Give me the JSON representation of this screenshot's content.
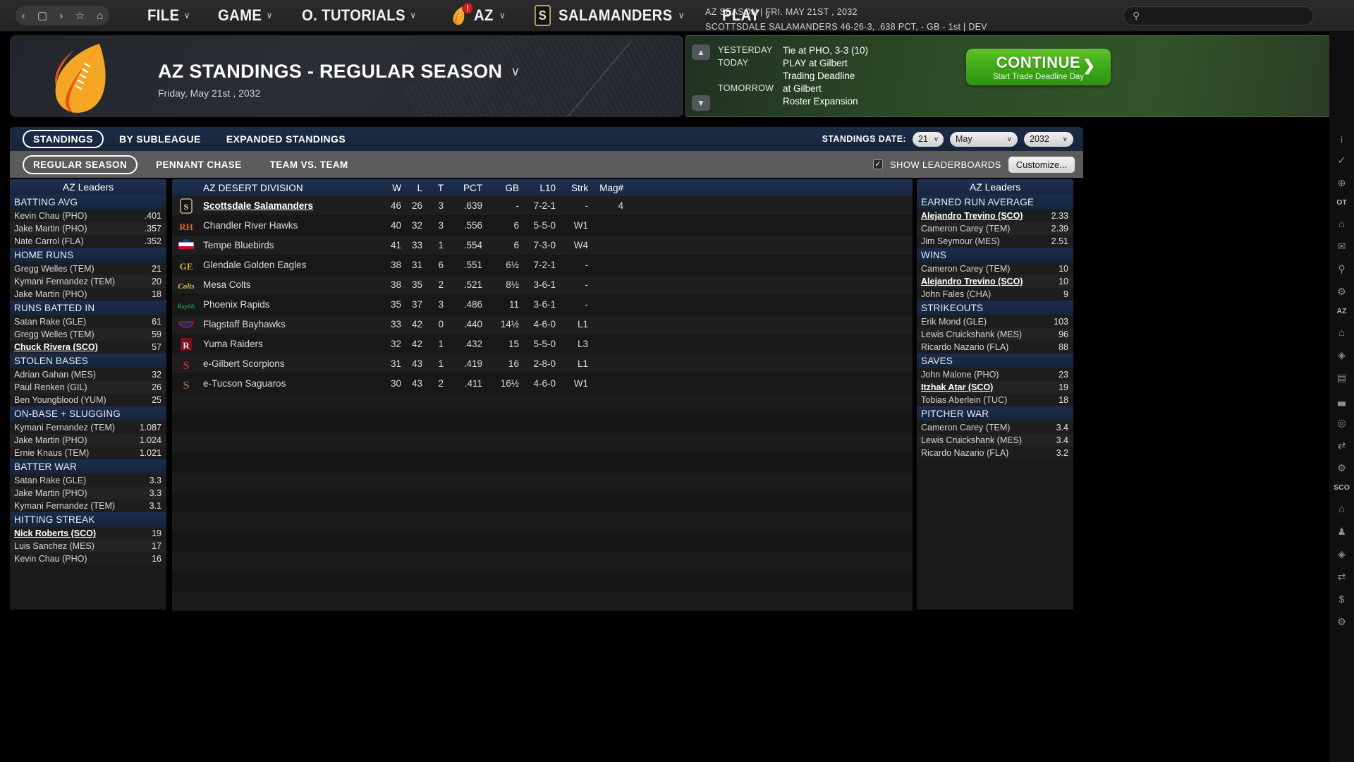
{
  "topbar": {
    "nav_icons": [
      "back-icon",
      "page-icon",
      "forward-icon",
      "star-icon",
      "home-icon"
    ],
    "menus": [
      {
        "label": "FILE",
        "caret": "∨"
      },
      {
        "label": "GAME",
        "caret": "∨"
      },
      {
        "label": "O. TUTORIALS",
        "caret": "∨"
      },
      {
        "label": "AZ",
        "caret": "∨",
        "badge": "!"
      },
      {
        "label": "SALAMANDERS",
        "caret": "∨"
      },
      {
        "label": "PLAY",
        "caret": "∨"
      }
    ],
    "season_line1": "AZ SEASON  |  FRI. MAY 21ST , 2032",
    "season_line2": "SCOTTSDALE SALAMANDERS   46-26-3, .638 PCT, - GB - 1st | DEV",
    "search_placeholder": ""
  },
  "banner": {
    "title": "AZ STANDINGS - REGULAR SEASON",
    "caret": "∨",
    "subtitle": "Friday, May 21st , 2032"
  },
  "schedule": {
    "rows": [
      {
        "when": "YESTERDAY",
        "what": "Tie at PHO, 3-3 (10)"
      },
      {
        "when": "TODAY",
        "what": "PLAY at Gilbert"
      },
      {
        "when": "",
        "what": "Trading Deadline"
      },
      {
        "when": "TOMORROW",
        "what": "at Gilbert"
      },
      {
        "when": "",
        "what": "Roster Expansion"
      }
    ],
    "continue_label": "CONTINUE",
    "continue_sub": "Start Trade Deadline Day",
    "continue_arrow": "❯",
    "expand_icon": "»",
    "accent_color": "#3faa18"
  },
  "tabs_primary": [
    {
      "label": "STANDINGS",
      "active": true
    },
    {
      "label": "BY SUBLEAGUE",
      "active": false
    },
    {
      "label": "EXPANDED STANDINGS",
      "active": false
    }
  ],
  "tabs_secondary": [
    {
      "label": "REGULAR SEASON",
      "active": true
    },
    {
      "label": "PENNANT CHASE",
      "active": false
    },
    {
      "label": "TEAM VS. TEAM",
      "active": false
    }
  ],
  "standings_date": {
    "label": "STANDINGS DATE:",
    "day": "21",
    "month": "May",
    "year": "2032",
    "caret": "∨"
  },
  "leaderboard_controls": {
    "checkbox_checked": "✓",
    "show_leaderboards_label": "SHOW LEADERBOARDS",
    "customize_label": "Customize..."
  },
  "leaders_left": {
    "title": "AZ Leaders",
    "categories": [
      {
        "name": "BATTING AVG",
        "rows": [
          {
            "player": "Kevin Chau (PHO)",
            "value": ".401",
            "highlight": false
          },
          {
            "player": "Jake Martin (PHO)",
            "value": ".357",
            "highlight": false
          },
          {
            "player": "Nate Carrol (FLA)",
            "value": ".352",
            "highlight": false
          }
        ]
      },
      {
        "name": "HOME RUNS",
        "rows": [
          {
            "player": "Gregg Welles (TEM)",
            "value": "21",
            "highlight": false
          },
          {
            "player": "Kymani Fernandez (TEM)",
            "value": "20",
            "highlight": false
          },
          {
            "player": "Jake Martin (PHO)",
            "value": "18",
            "highlight": false
          }
        ]
      },
      {
        "name": "RUNS BATTED IN",
        "rows": [
          {
            "player": "Satan Rake (GLE)",
            "value": "61",
            "highlight": false
          },
          {
            "player": "Gregg Welles (TEM)",
            "value": "59",
            "highlight": false
          },
          {
            "player": "Chuck Rivera (SCO)",
            "value": "57",
            "highlight": true
          }
        ]
      },
      {
        "name": "STOLEN BASES",
        "rows": [
          {
            "player": "Adrian Gahan (MES)",
            "value": "32",
            "highlight": false
          },
          {
            "player": "Paul Renken (GIL)",
            "value": "26",
            "highlight": false
          },
          {
            "player": "Ben Youngblood (YUM)",
            "value": "25",
            "highlight": false
          }
        ]
      },
      {
        "name": "ON-BASE + SLUGGING",
        "rows": [
          {
            "player": "Kymani Fernandez (TEM)",
            "value": "1.087",
            "highlight": false
          },
          {
            "player": "Jake Martin (PHO)",
            "value": "1.024",
            "highlight": false
          },
          {
            "player": "Ernie Knaus (TEM)",
            "value": "1.021",
            "highlight": false
          }
        ]
      },
      {
        "name": "BATTER WAR",
        "rows": [
          {
            "player": "Satan Rake (GLE)",
            "value": "3.3",
            "highlight": false
          },
          {
            "player": "Jake Martin (PHO)",
            "value": "3.3",
            "highlight": false
          },
          {
            "player": "Kymani Fernandez (TEM)",
            "value": "3.1",
            "highlight": false
          }
        ]
      },
      {
        "name": "HITTING STREAK",
        "rows": [
          {
            "player": "Nick Roberts (SCO)",
            "value": "19",
            "highlight": true
          },
          {
            "player": "Luis Sanchez (MES)",
            "value": "17",
            "highlight": false
          },
          {
            "player": "Kevin Chau (PHO)",
            "value": "16",
            "highlight": false
          }
        ]
      }
    ]
  },
  "leaders_right": {
    "title": "AZ Leaders",
    "categories": [
      {
        "name": "EARNED RUN AVERAGE",
        "rows": [
          {
            "player": "Alejandro Trevino (SCO)",
            "value": "2.33",
            "highlight": true
          },
          {
            "player": "Cameron Carey (TEM)",
            "value": "2.39",
            "highlight": false
          },
          {
            "player": "Jim Seymour (MES)",
            "value": "2.51",
            "highlight": false
          }
        ]
      },
      {
        "name": "WINS",
        "rows": [
          {
            "player": "Cameron Carey (TEM)",
            "value": "10",
            "highlight": false
          },
          {
            "player": "Alejandro Trevino (SCO)",
            "value": "10",
            "highlight": true
          },
          {
            "player": "John Fales (CHA)",
            "value": "9",
            "highlight": false
          }
        ]
      },
      {
        "name": "STRIKEOUTS",
        "rows": [
          {
            "player": "Erik Mond (GLE)",
            "value": "103",
            "highlight": false
          },
          {
            "player": "Lewis Cruickshank (MES)",
            "value": "96",
            "highlight": false
          },
          {
            "player": "Ricardo Nazario (FLA)",
            "value": "88",
            "highlight": false
          }
        ]
      },
      {
        "name": "SAVES",
        "rows": [
          {
            "player": "John Malone (PHO)",
            "value": "23",
            "highlight": false
          },
          {
            "player": "Itzhak Atar (SCO)",
            "value": "19",
            "highlight": true
          },
          {
            "player": "Tobias Aberlein (TUC)",
            "value": "18",
            "highlight": false
          }
        ]
      },
      {
        "name": "PITCHER WAR",
        "rows": [
          {
            "player": "Cameron Carey (TEM)",
            "value": "3.4",
            "highlight": false
          },
          {
            "player": "Lewis Cruickshank (MES)",
            "value": "3.4",
            "highlight": false
          },
          {
            "player": "Ricardo Nazario (FLA)",
            "value": "3.2",
            "highlight": false
          }
        ]
      }
    ]
  },
  "standings": {
    "division_label": "AZ DESERT DIVISION",
    "columns": [
      "W",
      "L",
      "T",
      "PCT",
      "GB",
      "L10",
      "Strk",
      "Mag#"
    ],
    "rows": [
      {
        "team": "Scottsdale Salamanders",
        "w": "46",
        "l": "26",
        "t": "3",
        "pct": ".639",
        "gb": "-",
        "l10": "7-2-1",
        "strk": "-",
        "mag": "4",
        "mine": true,
        "logo": "salamanders-logo"
      },
      {
        "team": "Chandler River Hawks",
        "w": "40",
        "l": "32",
        "t": "3",
        "pct": ".556",
        "gb": "6",
        "l10": "5-5-0",
        "strk": "W1",
        "mag": "",
        "mine": false,
        "logo": "river-hawks-logo"
      },
      {
        "team": "Tempe Bluebirds",
        "w": "41",
        "l": "33",
        "t": "1",
        "pct": ".554",
        "gb": "6",
        "l10": "7-3-0",
        "strk": "W4",
        "mag": "",
        "mine": false,
        "logo": "bluebirds-logo"
      },
      {
        "team": "Glendale Golden Eagles",
        "w": "38",
        "l": "31",
        "t": "6",
        "pct": ".551",
        "gb": "6½",
        "l10": "7-2-1",
        "strk": "-",
        "mag": "",
        "mine": false,
        "logo": "golden-eagles-logo"
      },
      {
        "team": "Mesa Colts",
        "w": "38",
        "l": "35",
        "t": "2",
        "pct": ".521",
        "gb": "8½",
        "l10": "3-6-1",
        "strk": "-",
        "mag": "",
        "mine": false,
        "logo": "colts-logo"
      },
      {
        "team": "Phoenix Rapids",
        "w": "35",
        "l": "37",
        "t": "3",
        "pct": ".486",
        "gb": "11",
        "l10": "3-6-1",
        "strk": "-",
        "mag": "",
        "mine": false,
        "logo": "rapids-logo"
      },
      {
        "team": "Flagstaff Bayhawks",
        "w": "33",
        "l": "42",
        "t": "0",
        "pct": ".440",
        "gb": "14½",
        "l10": "4-6-0",
        "strk": "L1",
        "mag": "",
        "mine": false,
        "logo": "bayhawks-logo"
      },
      {
        "team": "Yuma Raiders",
        "w": "32",
        "l": "42",
        "t": "1",
        "pct": ".432",
        "gb": "15",
        "l10": "5-5-0",
        "strk": "L3",
        "mag": "",
        "mine": false,
        "logo": "raiders-logo"
      },
      {
        "team": "e-Gilbert Scorpions",
        "w": "31",
        "l": "43",
        "t": "1",
        "pct": ".419",
        "gb": "16",
        "l10": "2-8-0",
        "strk": "L1",
        "mag": "",
        "mine": false,
        "logo": "scorpions-logo"
      },
      {
        "team": "e-Tucson Saguaros",
        "w": "30",
        "l": "43",
        "t": "2",
        "pct": ".411",
        "gb": "16½",
        "l10": "4-6-0",
        "strk": "W1",
        "mag": "",
        "mine": false,
        "logo": "saguaros-logo"
      }
    ]
  },
  "rail": {
    "items": [
      {
        "type": "icon",
        "name": "lightbulb-icon",
        "glyph": "¡"
      },
      {
        "type": "icon",
        "name": "check-icon",
        "glyph": "✓"
      },
      {
        "type": "icon",
        "name": "globe-icon",
        "glyph": "⊕"
      },
      {
        "type": "text",
        "name": "rail-label-ot",
        "glyph": "OT"
      },
      {
        "type": "icon",
        "name": "home-icon",
        "glyph": "⌂"
      },
      {
        "type": "icon",
        "name": "mail-icon",
        "glyph": "✉"
      },
      {
        "type": "icon",
        "name": "search-icon",
        "glyph": "⚲"
      },
      {
        "type": "icon",
        "name": "gear-icon",
        "glyph": "⚙"
      },
      {
        "type": "text",
        "name": "rail-label-az",
        "glyph": "AZ"
      },
      {
        "type": "icon",
        "name": "home-icon",
        "glyph": "⌂"
      },
      {
        "type": "icon",
        "name": "eye-icon",
        "glyph": "◈"
      },
      {
        "type": "icon",
        "name": "card-icon",
        "glyph": "▤"
      },
      {
        "type": "icon",
        "name": "chart-icon",
        "glyph": "▃"
      },
      {
        "type": "icon",
        "name": "baseball-icon",
        "glyph": "◎"
      },
      {
        "type": "icon",
        "name": "trade-icon",
        "glyph": "⇄"
      },
      {
        "type": "icon",
        "name": "gear-icon",
        "glyph": "⚙"
      },
      {
        "type": "text",
        "name": "rail-label-sco",
        "glyph": "SCO"
      },
      {
        "type": "icon",
        "name": "home-icon",
        "glyph": "⌂"
      },
      {
        "type": "icon",
        "name": "roster-icon",
        "glyph": "♟"
      },
      {
        "type": "icon",
        "name": "eye-icon",
        "glyph": "◈"
      },
      {
        "type": "icon",
        "name": "trade-icon",
        "glyph": "⇄"
      },
      {
        "type": "icon",
        "name": "dollar-icon",
        "glyph": "$"
      },
      {
        "type": "icon",
        "name": "gear-icon",
        "glyph": "⚙"
      }
    ]
  }
}
